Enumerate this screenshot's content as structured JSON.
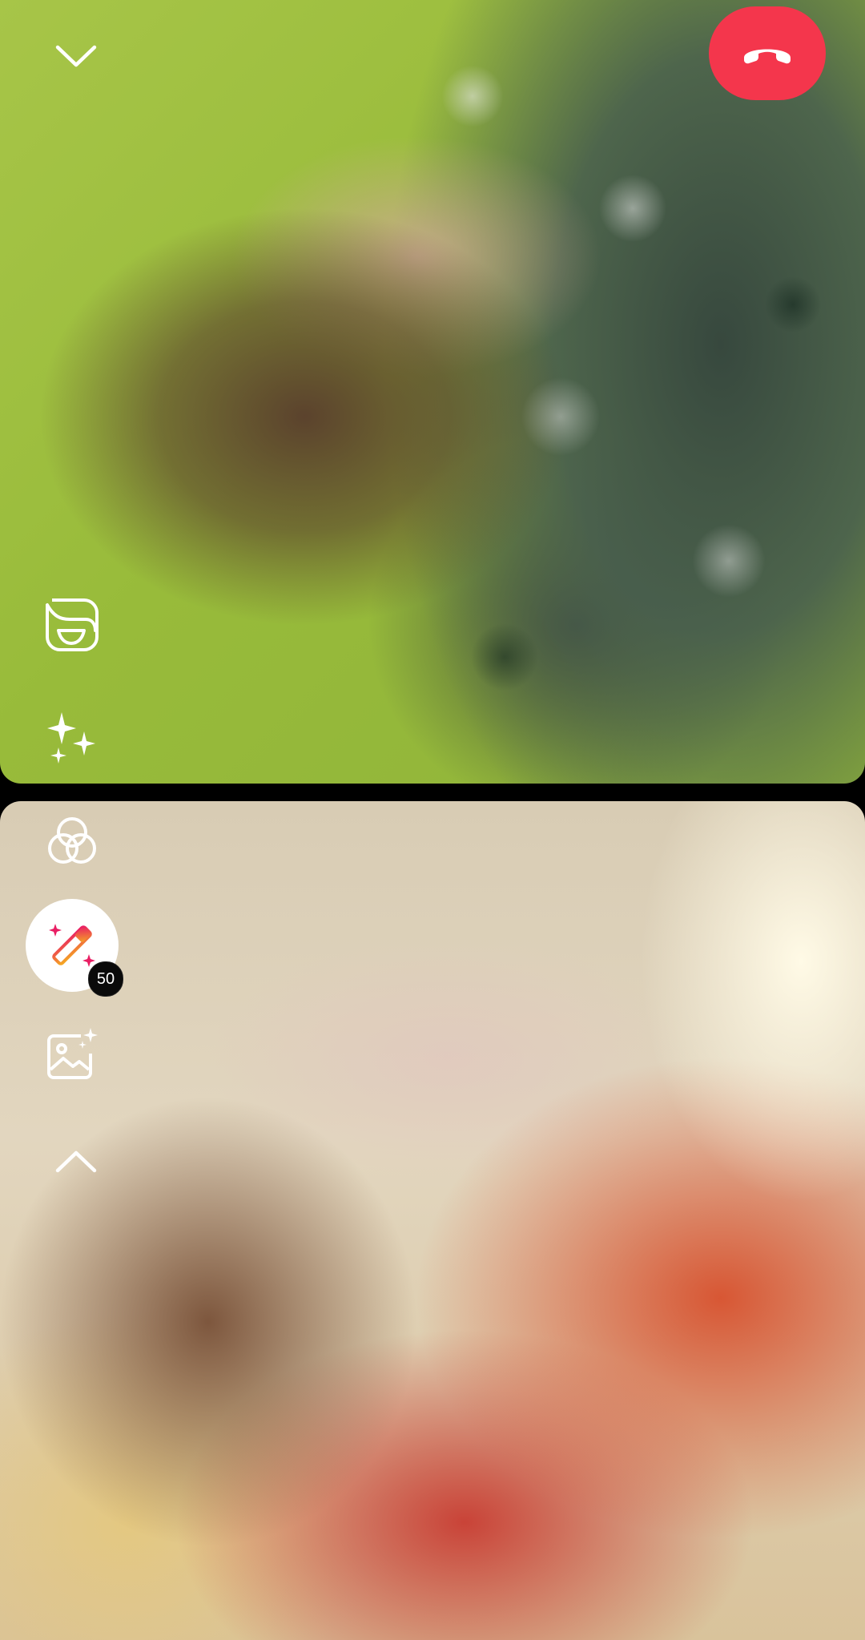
{
  "call": {
    "end_call_label": "",
    "effects_count": "50"
  },
  "icons": {
    "collapse": "chevron-down-icon",
    "end_call": "phone-hang-up-icon",
    "avatar_sticker": "avatar-sticker-icon",
    "effects": "sparkles-icon",
    "filters": "color-filters-icon",
    "magic": "magic-wand-icon",
    "background": "image-background-icon",
    "expand": "chevron-up-icon"
  },
  "colors": {
    "end_call": "#f4364c",
    "icon": "#ffffff",
    "magic_gradient_start": "#f5a623",
    "magic_gradient_end": "#e91e63"
  }
}
